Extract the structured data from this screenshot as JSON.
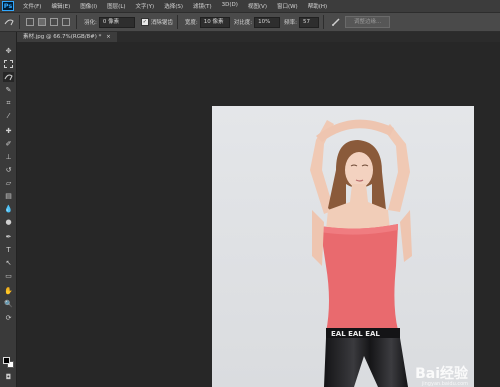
{
  "app": {
    "logo": "Ps"
  },
  "menu": [
    "文件(F)",
    "编辑(E)",
    "图像(I)",
    "图层(L)",
    "文字(Y)",
    "选择(S)",
    "滤镜(T)",
    "3D(D)",
    "视图(V)",
    "窗口(W)",
    "帮助(H)"
  ],
  "options": {
    "feather_label": "羽化:",
    "feather_value": "0 像素",
    "antialias_label": "消除锯齿",
    "width_label": "宽度:",
    "width_value": "10 像素",
    "contrast_label": "对比度:",
    "contrast_value": "10%",
    "frequency_label": "频率:",
    "frequency_value": "57",
    "refine_edge_button": "调整边缘..."
  },
  "document": {
    "tab_title": "素材.jpg @ 66.7%(RGB/8#) *"
  },
  "watermark": {
    "text": "Bai经验",
    "sub": "jingyan.baidu.com"
  },
  "colors": {
    "shirt": "#e96a6e",
    "skin": "#f1cdb8",
    "hair": "#8a5a3a",
    "pants": "#1d1d1f"
  }
}
